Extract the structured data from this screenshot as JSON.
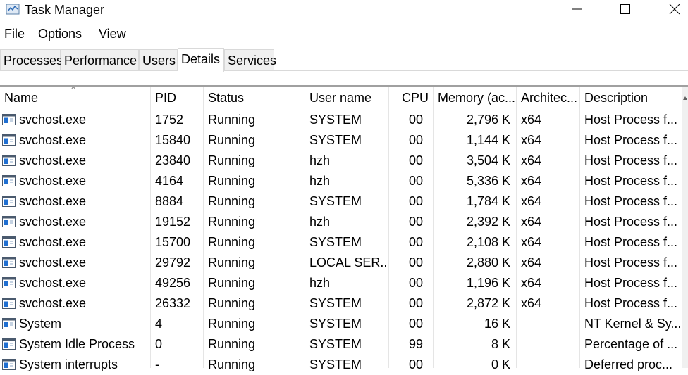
{
  "window": {
    "title": "Task Manager"
  },
  "menu": {
    "file": "File",
    "options": "Options",
    "view": "View"
  },
  "tabs": [
    {
      "label": "Processes",
      "active": false
    },
    {
      "label": "Performance",
      "active": false
    },
    {
      "label": "Users",
      "active": false
    },
    {
      "label": "Details",
      "active": true
    },
    {
      "label": "Services",
      "active": false
    }
  ],
  "columns": {
    "name": "Name",
    "pid": "PID",
    "status": "Status",
    "user": "User name",
    "cpu": "CPU",
    "memory": "Memory (ac...",
    "arch": "Architec...",
    "desc": "Description"
  },
  "sort": {
    "column": "name",
    "direction": "ascending"
  },
  "rows": [
    {
      "name": "svchost.exe",
      "pid": "1752",
      "status": "Running",
      "user": "SYSTEM",
      "cpu": "00",
      "memory": "2,796 K",
      "arch": "x64",
      "desc": "Host Process f..."
    },
    {
      "name": "svchost.exe",
      "pid": "15840",
      "status": "Running",
      "user": "SYSTEM",
      "cpu": "00",
      "memory": "1,144 K",
      "arch": "x64",
      "desc": "Host Process f..."
    },
    {
      "name": "svchost.exe",
      "pid": "23840",
      "status": "Running",
      "user": "hzh",
      "cpu": "00",
      "memory": "3,504 K",
      "arch": "x64",
      "desc": "Host Process f..."
    },
    {
      "name": "svchost.exe",
      "pid": "4164",
      "status": "Running",
      "user": "hzh",
      "cpu": "00",
      "memory": "5,336 K",
      "arch": "x64",
      "desc": "Host Process f..."
    },
    {
      "name": "svchost.exe",
      "pid": "8884",
      "status": "Running",
      "user": "SYSTEM",
      "cpu": "00",
      "memory": "1,784 K",
      "arch": "x64",
      "desc": "Host Process f..."
    },
    {
      "name": "svchost.exe",
      "pid": "19152",
      "status": "Running",
      "user": "hzh",
      "cpu": "00",
      "memory": "2,392 K",
      "arch": "x64",
      "desc": "Host Process f..."
    },
    {
      "name": "svchost.exe",
      "pid": "15700",
      "status": "Running",
      "user": "SYSTEM",
      "cpu": "00",
      "memory": "2,108 K",
      "arch": "x64",
      "desc": "Host Process f..."
    },
    {
      "name": "svchost.exe",
      "pid": "29792",
      "status": "Running",
      "user": "LOCAL SER...",
      "cpu": "00",
      "memory": "2,880 K",
      "arch": "x64",
      "desc": "Host Process f..."
    },
    {
      "name": "svchost.exe",
      "pid": "49256",
      "status": "Running",
      "user": "hzh",
      "cpu": "00",
      "memory": "1,196 K",
      "arch": "x64",
      "desc": "Host Process f..."
    },
    {
      "name": "svchost.exe",
      "pid": "26332",
      "status": "Running",
      "user": "SYSTEM",
      "cpu": "00",
      "memory": "2,872 K",
      "arch": "x64",
      "desc": "Host Process f..."
    },
    {
      "name": "System",
      "pid": "4",
      "status": "Running",
      "user": "SYSTEM",
      "cpu": "00",
      "memory": "16 K",
      "arch": "",
      "desc": "NT Kernel & Sy..."
    },
    {
      "name": "System Idle Process",
      "pid": "0",
      "status": "Running",
      "user": "SYSTEM",
      "cpu": "99",
      "memory": "8 K",
      "arch": "",
      "desc": "Percentage of ..."
    },
    {
      "name": "System interrupts",
      "pid": "-",
      "status": "Running",
      "user": "SYSTEM",
      "cpu": "00",
      "memory": "0 K",
      "arch": "",
      "desc": "Deferred proc..."
    }
  ],
  "colors": {
    "tab_border": "#d9d9d9",
    "tab_inactive_bg": "#f0f0f0",
    "icon_blue": "#1f6fd1"
  }
}
